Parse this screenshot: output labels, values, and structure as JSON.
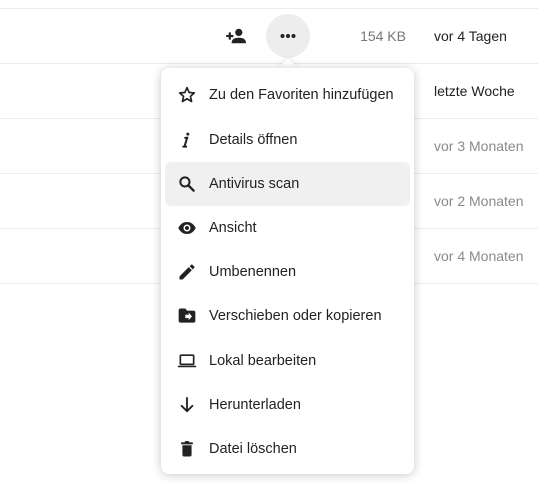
{
  "file_rows": [
    {
      "size": "154 KB",
      "modified": "vor 4 Tagen"
    },
    {
      "size": "",
      "modified": "letzte Woche"
    },
    {
      "size": "",
      "modified": "vor 3 Monaten"
    },
    {
      "size": "",
      "modified": "vor 2 Monaten"
    },
    {
      "size": "",
      "modified": "vor 4 Monaten"
    }
  ],
  "row_actions": {
    "share_icon": "share-user-icon",
    "more_icon": "more-dots-icon"
  },
  "context_menu": {
    "items": [
      {
        "label": "Zu den Favoriten hinzufügen",
        "icon": "star-icon"
      },
      {
        "label": "Details öffnen",
        "icon": "info-icon"
      },
      {
        "label": "Antivirus scan",
        "icon": "search-icon"
      },
      {
        "label": "Ansicht",
        "icon": "eye-icon"
      },
      {
        "label": "Umbenennen",
        "icon": "pencil-icon"
      },
      {
        "label": "Verschieben oder kopieren",
        "icon": "folder-move-icon"
      },
      {
        "label": "Lokal bearbeiten",
        "icon": "laptop-icon"
      },
      {
        "label": "Herunterladen",
        "icon": "download-icon"
      },
      {
        "label": "Datei löschen",
        "icon": "trash-icon"
      }
    ]
  }
}
